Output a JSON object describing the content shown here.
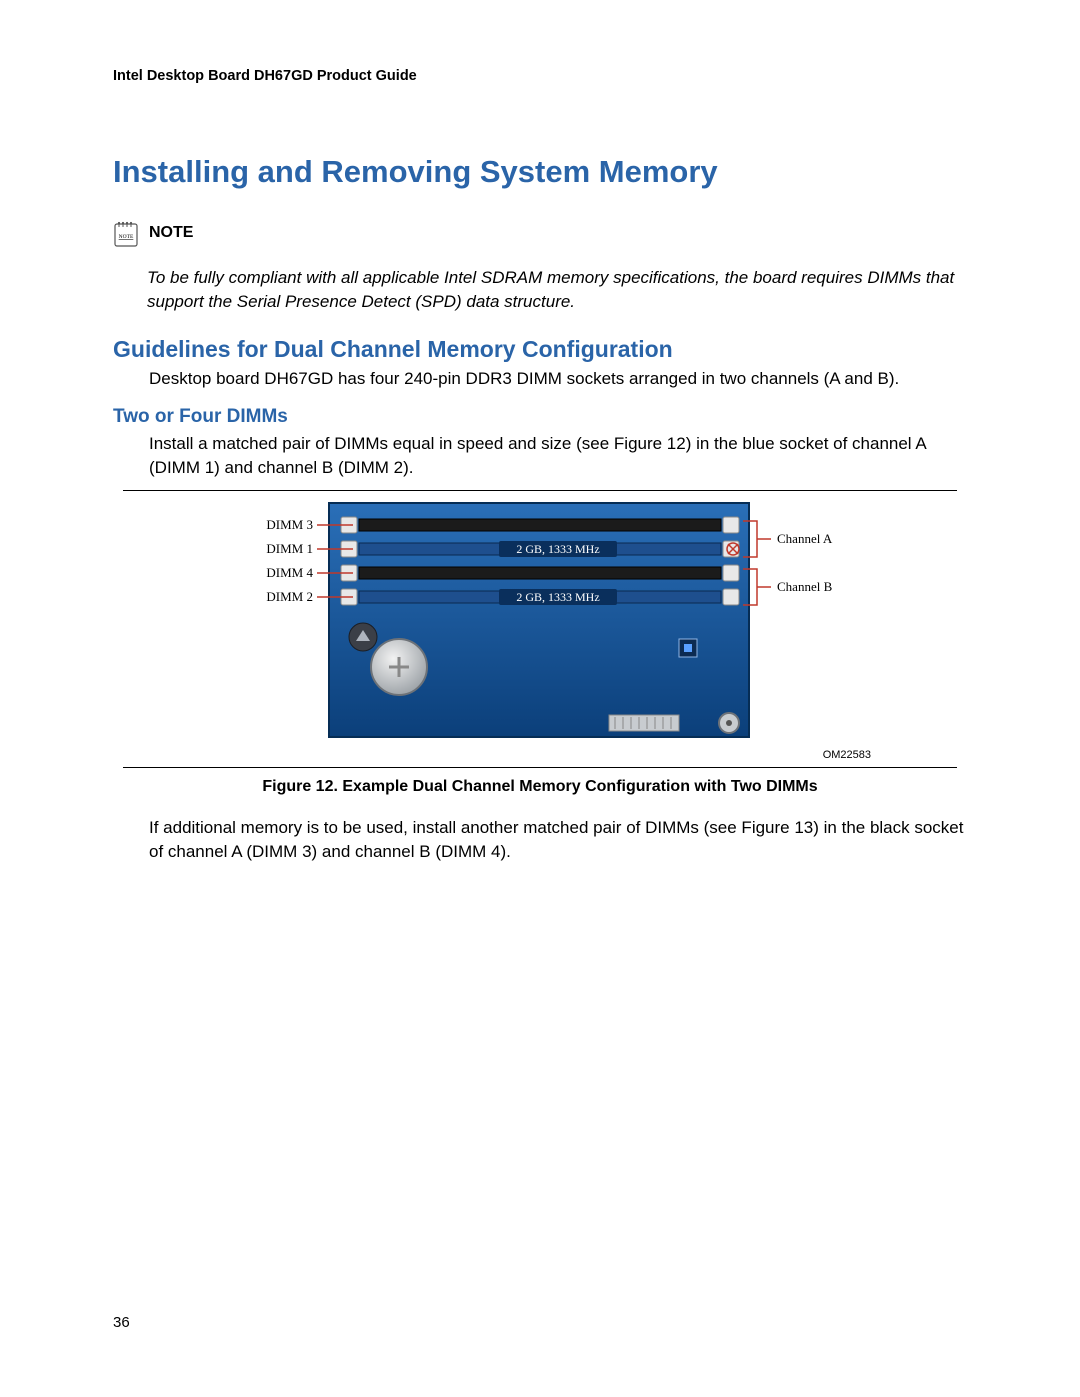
{
  "header": {
    "running_title": "Intel Desktop Board DH67GD Product Guide"
  },
  "title": "Installing and Removing System Memory",
  "note": {
    "label": "NOTE",
    "icon_text": "NOTE",
    "text": "To be fully compliant with all applicable Intel SDRAM memory specifications, the board requires DIMMs that support the Serial Presence Detect (SPD) data structure."
  },
  "section": {
    "heading": "Guidelines for Dual Channel Memory Configuration",
    "intro": "Desktop board DH67GD has four 240-pin DDR3 DIMM sockets arranged in two channels (A and B).",
    "subheading": "Two or Four DIMMs",
    "para1": "Install a matched pair of DIMMs equal in speed and size (see Figure 12) in the blue socket of channel A (DIMM 1) and channel B (DIMM 2).",
    "para2": "If additional memory is to be used, install another matched pair of DIMMs (see Figure 13) in the black socket of channel A (DIMM 3) and channel B (DIMM 4)."
  },
  "figure": {
    "caption": "Figure 12.  Example Dual Channel Memory Configuration with Two DIMMs",
    "om_id": "OM22583",
    "labels": {
      "dimm3": "DIMM 3",
      "dimm1": "DIMM 1",
      "dimm4": "DIMM 4",
      "dimm2": "DIMM 2",
      "channelA": "Channel A",
      "channelB": "Channel B",
      "module1": "2 GB, 1333 MHz",
      "module2": "2 GB, 1333 MHz"
    }
  },
  "page_number": "36"
}
